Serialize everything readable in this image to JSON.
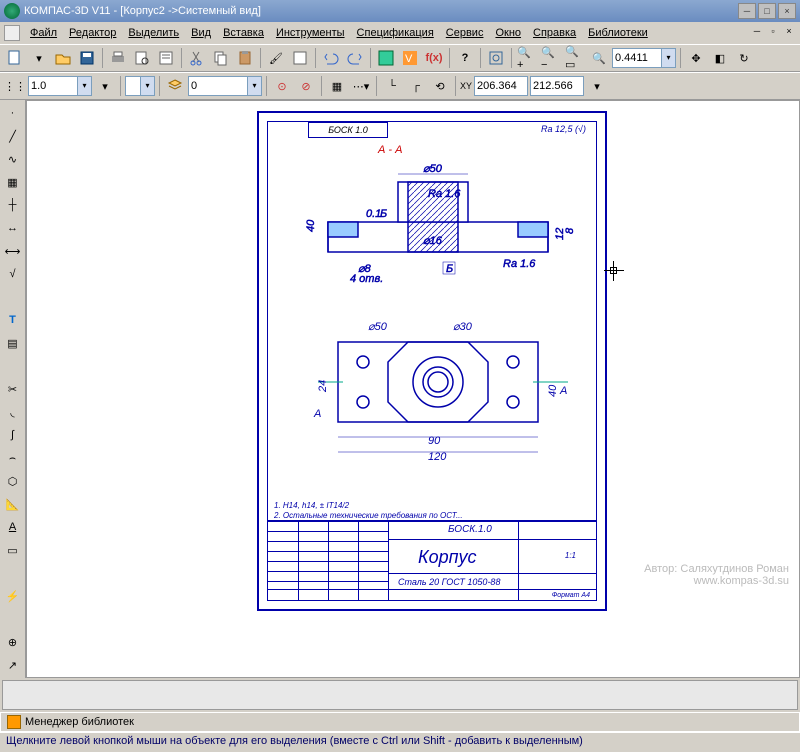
{
  "title": "КОМПАС-3D V11 - [Корпус2 ->Системный вид]",
  "menu": [
    "Файл",
    "Редактор",
    "Выделить",
    "Вид",
    "Вставка",
    "Инструменты",
    "Спецификация",
    "Сервис",
    "Окно",
    "Справка",
    "Библиотеки"
  ],
  "toolbar2": {
    "zoom_value": "0.4411"
  },
  "toolbar3": {
    "style_value": "1.0",
    "layer_value": "0",
    "coord_x": "206.364",
    "coord_y": "212.566"
  },
  "drawing": {
    "code_top": "БОСК 1.0",
    "section_label": "А - А",
    "surface_finish": "Ra 12,5 (√)",
    "dim_d50": "⌀50",
    "ra16": "Ra 1.6",
    "tol10": "0.1",
    "tol_b": "Б",
    "h40": "40",
    "h12": "12",
    "h8": "8",
    "d16": "⌀16",
    "d8": "⌀8",
    "holes4": "4 отв.",
    "d50_2": "⌀50",
    "d30": "⌀30",
    "w90": "90",
    "w120": "120",
    "w24": "24",
    "w40": "40",
    "sec_a1": "А",
    "sec_a2": "А",
    "note1": "1. H14, h14, ± IT14/2",
    "note2": "2. Остальные технические требования по ОСТ...",
    "tb_code": "БОСК.1.0",
    "tb_name": "Корпус",
    "tb_material": "Сталь 20 ГОСТ 1050-88",
    "tb_scale": "1:1",
    "tb_format": "Формат    А4"
  },
  "watermark": {
    "l1": "Автор: Саляхутдинов Роман",
    "l2": "www.kompas-3d.su"
  },
  "library_manager": "Менеджер библиотек",
  "statusbar": "Щелкните левой кнопкой мыши на объекте для его выделения (вместе с Ctrl или Shift - добавить к выделенным)"
}
